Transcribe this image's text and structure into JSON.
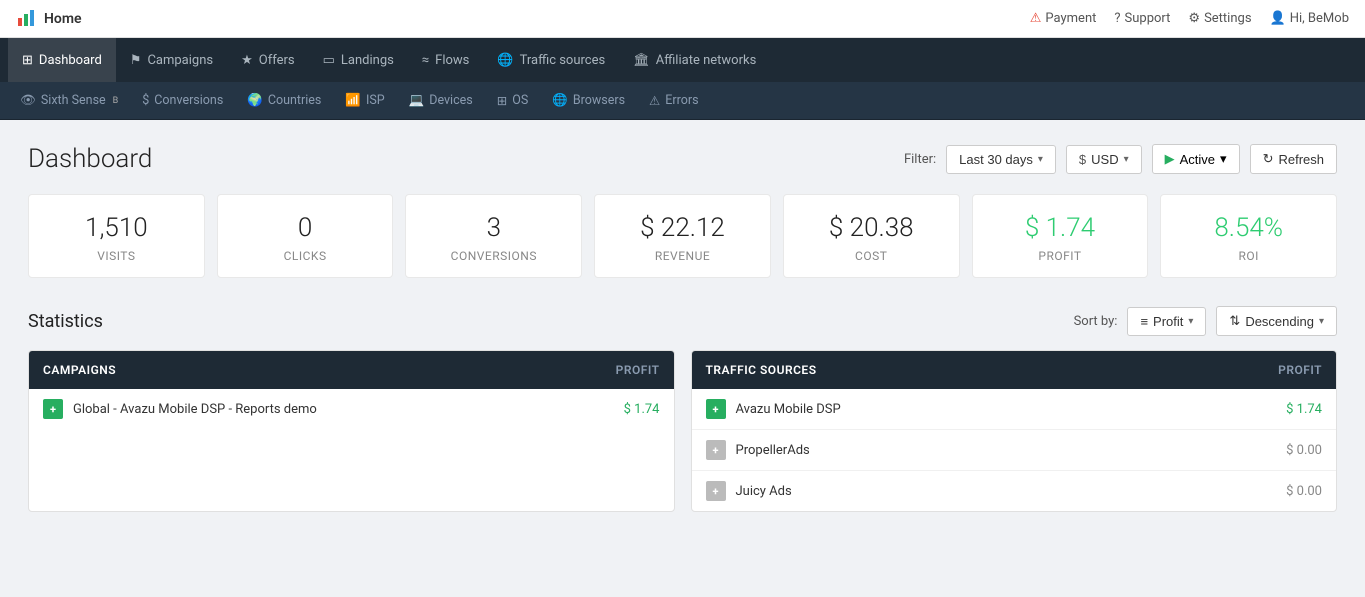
{
  "topbar": {
    "app_name": "Home",
    "right_items": [
      {
        "icon": "warning",
        "label": "Payment"
      },
      {
        "icon": "support",
        "label": "Support"
      },
      {
        "icon": "settings",
        "label": "Settings"
      },
      {
        "icon": "user",
        "label": "Hi, BeMob"
      }
    ]
  },
  "main_nav": {
    "items": [
      {
        "id": "dashboard",
        "icon": "grid",
        "label": "Dashboard",
        "active": true
      },
      {
        "id": "campaigns",
        "icon": "flag",
        "label": "Campaigns",
        "active": false
      },
      {
        "id": "offers",
        "icon": "star",
        "label": "Offers",
        "active": false
      },
      {
        "id": "landings",
        "icon": "monitor",
        "label": "Landings",
        "active": false
      },
      {
        "id": "flows",
        "icon": "flow",
        "label": "Flows",
        "active": false
      },
      {
        "id": "traffic-sources",
        "icon": "globe",
        "label": "Traffic sources",
        "active": false
      },
      {
        "id": "affiliate-networks",
        "icon": "building",
        "label": "Affiliate networks",
        "active": false
      }
    ]
  },
  "sub_nav": {
    "items": [
      {
        "id": "sixth-sense",
        "icon": "eye",
        "label": "Sixth Sense",
        "beta": true
      },
      {
        "id": "conversions",
        "icon": "dollar",
        "label": "Conversions"
      },
      {
        "id": "countries",
        "icon": "globe2",
        "label": "Countries"
      },
      {
        "id": "isp",
        "icon": "wifi",
        "label": "ISP"
      },
      {
        "id": "devices",
        "icon": "laptop",
        "label": "Devices"
      },
      {
        "id": "os",
        "icon": "grid2",
        "label": "OS"
      },
      {
        "id": "browsers",
        "icon": "browser",
        "label": "Browsers"
      },
      {
        "id": "errors",
        "icon": "alert",
        "label": "Errors"
      }
    ]
  },
  "dashboard": {
    "title": "Dashboard",
    "filter": {
      "label": "Filter:",
      "date_range": "Last 30 days",
      "currency": "USD",
      "active_label": "Active",
      "refresh_label": "Refresh"
    },
    "stats": [
      {
        "id": "visits",
        "value": "1,510",
        "label": "Visits",
        "green": false
      },
      {
        "id": "clicks",
        "value": "0",
        "label": "Clicks",
        "green": false
      },
      {
        "id": "conversions",
        "value": "3",
        "label": "Conversions",
        "green": false
      },
      {
        "id": "revenue",
        "value": "$ 22.12",
        "label": "Revenue",
        "green": false
      },
      {
        "id": "cost",
        "value": "$ 20.38",
        "label": "Cost",
        "green": false
      },
      {
        "id": "profit",
        "value": "$ 1.74",
        "label": "Profit",
        "green": true
      },
      {
        "id": "roi",
        "value": "8.54%",
        "label": "ROI",
        "green": true
      }
    ],
    "statistics": {
      "title": "Statistics",
      "sort_label": "Sort by:",
      "sort_field": "Profit",
      "sort_direction": "Descending"
    },
    "campaigns_table": {
      "header": "CAMPAIGNS",
      "profit_header": "PROFIT",
      "rows": [
        {
          "name": "Global - Avazu Mobile DSP - Reports demo",
          "profit": "$ 1.74",
          "green": true
        }
      ]
    },
    "traffic_sources_table": {
      "header": "TRAFFIC SOURCES",
      "profit_header": "PROFIT",
      "rows": [
        {
          "name": "Avazu Mobile DSP",
          "profit": "$ 1.74",
          "green": true
        },
        {
          "name": "PropellerAds",
          "profit": "$ 0.00",
          "green": false
        },
        {
          "name": "Juicy Ads",
          "profit": "$ 0.00",
          "green": false
        }
      ]
    }
  }
}
